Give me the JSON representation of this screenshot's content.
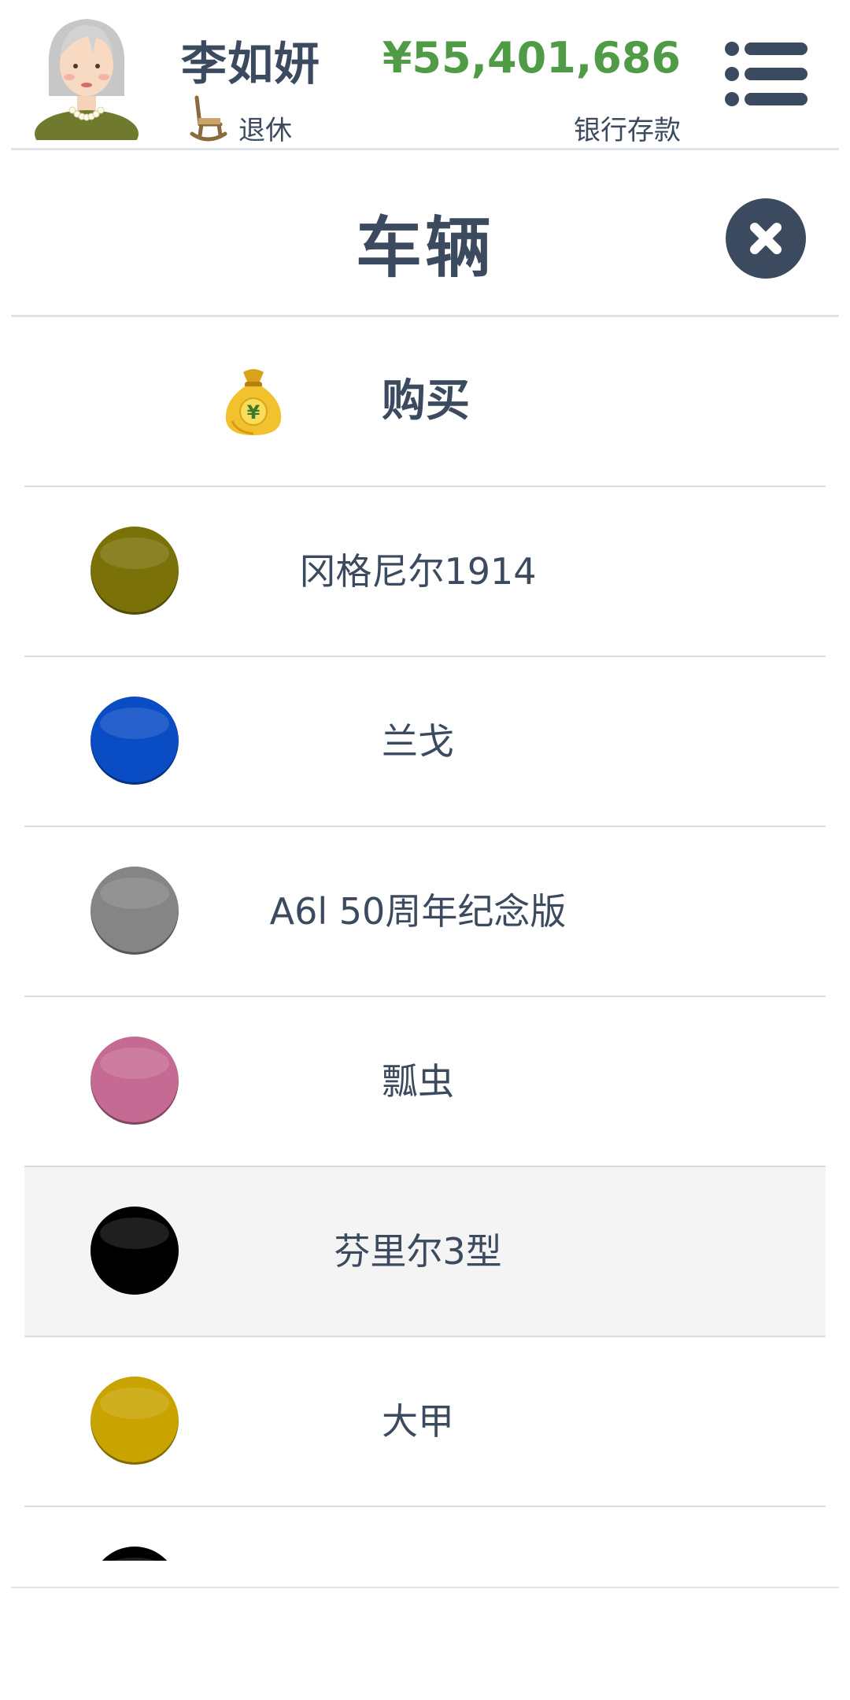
{
  "header": {
    "player_name": "李如妍",
    "status": "退休",
    "money": "¥55,401,686",
    "money_label": "银行存款"
  },
  "title": "车辆",
  "buy": {
    "label": "购买",
    "icon": "moneybag-icon"
  },
  "vehicles": [
    {
      "name": "冈格尼尔1914",
      "color": "#7a7208"
    },
    {
      "name": "兰戈",
      "color": "#0a4cc4"
    },
    {
      "name": "A6l 50周年纪念版",
      "color": "#858585"
    },
    {
      "name": "瓢虫",
      "color": "#c56b93"
    },
    {
      "name": "芬里尔3型",
      "color": "#000000",
      "selected": true
    },
    {
      "name": "大甲",
      "color": "#c9a400"
    },
    {
      "name": "",
      "color": "#000000"
    }
  ],
  "colors": {
    "text": "#3b4a5e",
    "money": "#4f9b46"
  }
}
